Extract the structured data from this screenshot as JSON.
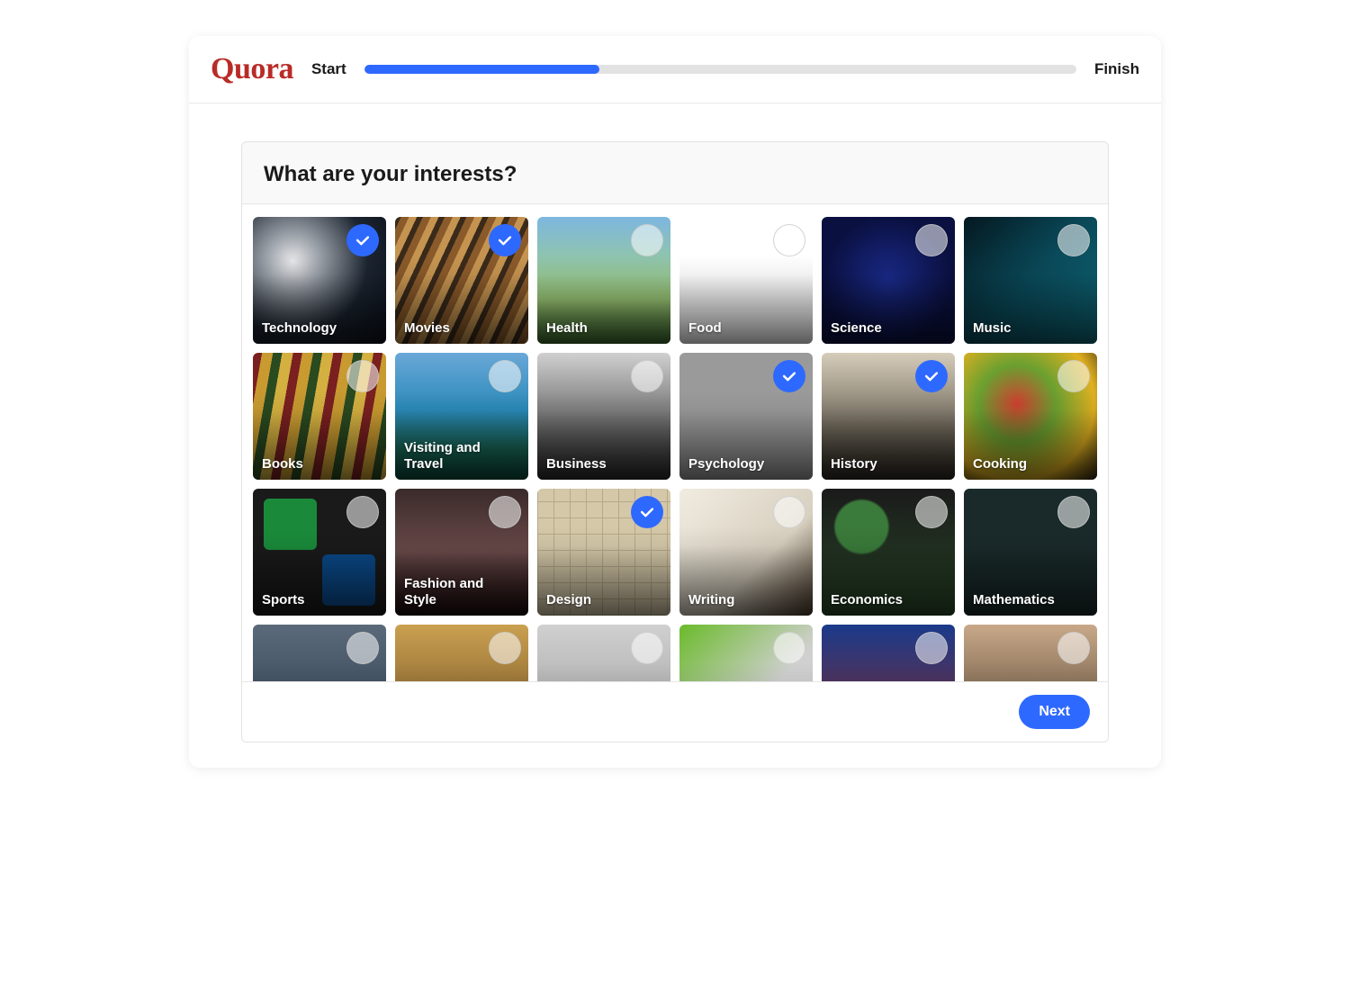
{
  "brand": "Quora",
  "progress": {
    "start_label": "Start",
    "finish_label": "Finish",
    "percent": 33
  },
  "panel": {
    "title": "What are your interests?",
    "next_label": "Next"
  },
  "interests": [
    {
      "label": "Technology",
      "selected": true,
      "bg": "bg-technology"
    },
    {
      "label": "Movies",
      "selected": true,
      "bg": "bg-movies"
    },
    {
      "label": "Health",
      "selected": false,
      "bg": "bg-health"
    },
    {
      "label": "Food",
      "selected": false,
      "bg": "bg-food"
    },
    {
      "label": "Science",
      "selected": false,
      "bg": "bg-science"
    },
    {
      "label": "Music",
      "selected": false,
      "bg": "bg-music"
    },
    {
      "label": "Books",
      "selected": false,
      "bg": "bg-books"
    },
    {
      "label": "Visiting and Travel",
      "selected": false,
      "bg": "bg-travel"
    },
    {
      "label": "Business",
      "selected": false,
      "bg": "bg-business"
    },
    {
      "label": "Psychology",
      "selected": true,
      "bg": "bg-psychology"
    },
    {
      "label": "History",
      "selected": true,
      "bg": "bg-history"
    },
    {
      "label": "Cooking",
      "selected": false,
      "bg": "bg-cooking"
    },
    {
      "label": "Sports",
      "selected": false,
      "bg": "bg-sports"
    },
    {
      "label": "Fashion and Style",
      "selected": false,
      "bg": "bg-fashion"
    },
    {
      "label": "Design",
      "selected": true,
      "bg": "bg-design"
    },
    {
      "label": "Writing",
      "selected": false,
      "bg": "bg-writing"
    },
    {
      "label": "Economics",
      "selected": false,
      "bg": "bg-economics"
    },
    {
      "label": "Mathematics",
      "selected": false,
      "bg": "bg-mathematics"
    },
    {
      "label": "",
      "selected": false,
      "bg": "bg-extra1"
    },
    {
      "label": "",
      "selected": false,
      "bg": "bg-extra2"
    },
    {
      "label": "",
      "selected": false,
      "bg": "bg-extra3"
    },
    {
      "label": "",
      "selected": false,
      "bg": "bg-extra4"
    },
    {
      "label": "",
      "selected": false,
      "bg": "bg-extra5"
    },
    {
      "label": "",
      "selected": false,
      "bg": "bg-extra6"
    }
  ]
}
